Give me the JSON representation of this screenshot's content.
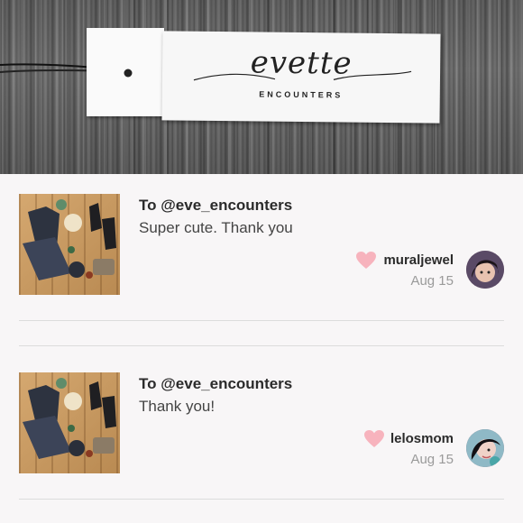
{
  "header": {
    "brand_name": "evette",
    "brand_subtitle": "ENCOUNTERS"
  },
  "comments": [
    {
      "to": "To @eve_encounters",
      "message": "Super cute. Thank you",
      "username": "muraljewel",
      "date": "Aug 15",
      "heart_icon": "heart-icon",
      "heart_color": "#f7b3bd"
    },
    {
      "to": "To @eve_encounters",
      "message": "Thank you!",
      "username": "lelosmom",
      "date": "Aug 15",
      "heart_icon": "heart-icon",
      "heart_color": "#f7b3bd"
    }
  ]
}
